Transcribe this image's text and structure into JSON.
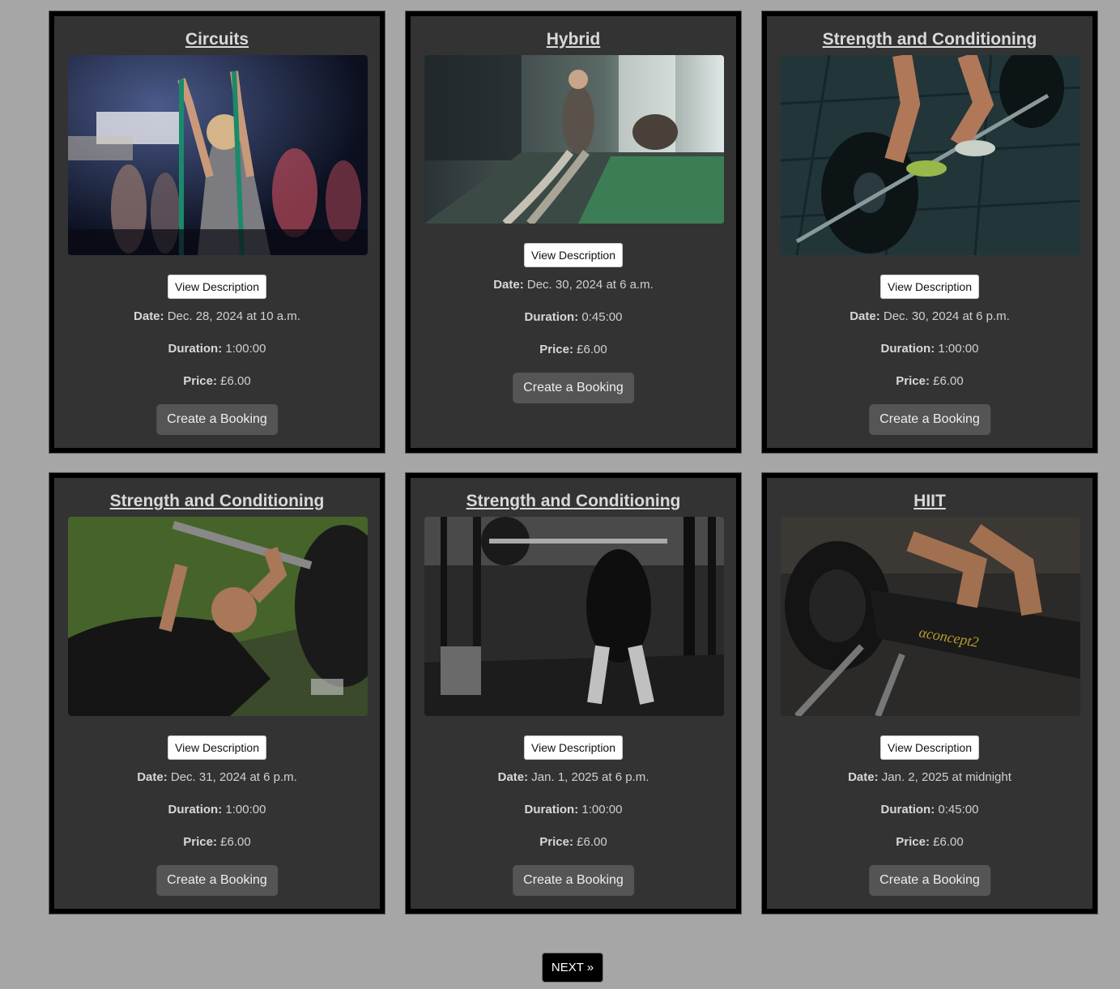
{
  "labels": {
    "view_description": "View Description",
    "date": "Date:",
    "duration": "Duration:",
    "price": "Price:",
    "create_booking": "Create a Booking"
  },
  "classes": [
    {
      "title": "Circuits",
      "date": "Dec. 28, 2024 at 10 a.m.",
      "duration": "1:00:00",
      "price": "£6.00",
      "image": "group-resistance-band-class-photo"
    },
    {
      "title": "Hybrid",
      "date": "Dec. 30, 2024 at 6 a.m.",
      "duration": "0:45:00",
      "price": "£6.00",
      "image": "battle-ropes-gym-photo"
    },
    {
      "title": "Strength and Conditioning",
      "date": "Dec. 30, 2024 at 6 p.m.",
      "duration": "1:00:00",
      "price": "£6.00",
      "image": "barbell-deadlift-photo"
    },
    {
      "title": "Strength and Conditioning",
      "date": "Dec. 31, 2024 at 6 p.m.",
      "duration": "1:00:00",
      "price": "£6.00",
      "image": "bench-press-photo"
    },
    {
      "title": "Strength and Conditioning",
      "date": "Jan. 1, 2025 at 6 p.m.",
      "duration": "1:00:00",
      "price": "£6.00",
      "image": "squat-rack-photo"
    },
    {
      "title": "HIIT",
      "date": "Jan. 2, 2025 at midnight",
      "duration": "0:45:00",
      "price": "£6.00",
      "image": "rowing-machine-photo"
    }
  ],
  "pagination": {
    "next_label": "NEXT »"
  },
  "colors": {
    "page_background": "#a6a6a6",
    "card_background": "#333333",
    "card_border": "#000000",
    "booking_button": "#555555",
    "next_button": "#000000"
  }
}
